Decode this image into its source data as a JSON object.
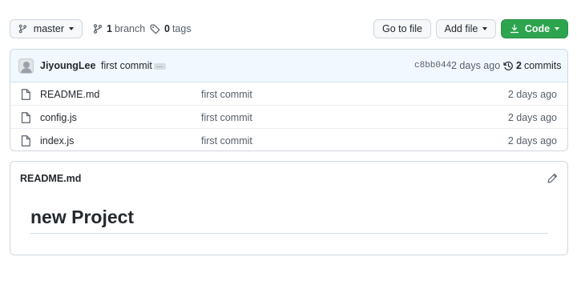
{
  "toolbar": {
    "branch_button": {
      "label": "master",
      "icon": "git-branch-icon"
    },
    "branches": {
      "count": "1",
      "label": "branch",
      "icon": "git-branch-icon"
    },
    "tags": {
      "count": "0",
      "label": "tags",
      "icon": "tag-icon"
    },
    "go_to_file_label": "Go to file",
    "add_file_label": "Add file",
    "code_button": {
      "label": "Code",
      "icon": "download-icon",
      "color": "#2da44e"
    }
  },
  "commit": {
    "author": "JiyoungLee",
    "message": "first commit",
    "ellipsis": "…",
    "sha": "c8bb044",
    "time": "2 days ago",
    "commits_count": "2",
    "commits_label": "commits",
    "history_icon": "history-icon"
  },
  "files": [
    {
      "name": "README.md",
      "message": "first commit",
      "time": "2 days ago",
      "icon": "file-icon"
    },
    {
      "name": "config.js",
      "message": "first commit",
      "time": "2 days ago",
      "icon": "file-icon"
    },
    {
      "name": "index.js",
      "message": "first commit",
      "time": "2 days ago",
      "icon": "file-icon"
    }
  ],
  "readme": {
    "title": "README.md",
    "heading": "new Project",
    "edit_icon": "pencil-icon"
  }
}
